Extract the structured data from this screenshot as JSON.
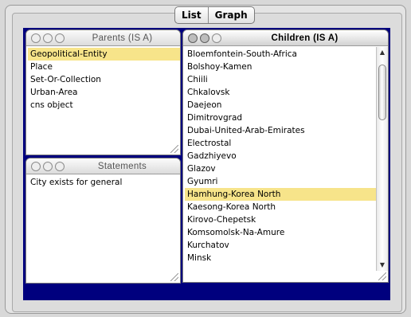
{
  "tabs": [
    {
      "label": "List",
      "selected": true
    },
    {
      "label": "Graph",
      "selected": false
    }
  ],
  "parents_panel": {
    "title": "Parents (IS A)",
    "items": [
      {
        "label": "Geopolitical-Entity",
        "selected": true
      },
      {
        "label": "Place",
        "selected": false
      },
      {
        "label": "Set-Or-Collection",
        "selected": false
      },
      {
        "label": "Urban-Area",
        "selected": false
      },
      {
        "label": "cns object",
        "selected": false
      }
    ]
  },
  "statements_panel": {
    "title": "Statements",
    "items": [
      {
        "label": "City exists for general",
        "selected": false
      }
    ]
  },
  "children_panel": {
    "title": "Children (IS A)",
    "items": [
      {
        "label": "Bloemfontein-South-Africa",
        "selected": false
      },
      {
        "label": "Bolshoy-Kamen",
        "selected": false
      },
      {
        "label": "Chiili",
        "selected": false
      },
      {
        "label": "Chkalovsk",
        "selected": false
      },
      {
        "label": "Daejeon",
        "selected": false
      },
      {
        "label": "Dimitrovgrad",
        "selected": false
      },
      {
        "label": "Dubai-United-Arab-Emirates",
        "selected": false
      },
      {
        "label": "Electrostal",
        "selected": false
      },
      {
        "label": "Gadzhiyevo",
        "selected": false
      },
      {
        "label": "Glazov",
        "selected": false
      },
      {
        "label": "Gyumri",
        "selected": false
      },
      {
        "label": "Hamhung-Korea North",
        "selected": true
      },
      {
        "label": "Kaesong-Korea North",
        "selected": false
      },
      {
        "label": "Kirovo-Chepetsk",
        "selected": false
      },
      {
        "label": "Komsomolsk-Na-Amure",
        "selected": false
      },
      {
        "label": "Kurchatov",
        "selected": false
      },
      {
        "label": "Minsk",
        "selected": false
      }
    ]
  },
  "colors": {
    "background_area": "#00007e",
    "selection": "#f7e48a"
  }
}
